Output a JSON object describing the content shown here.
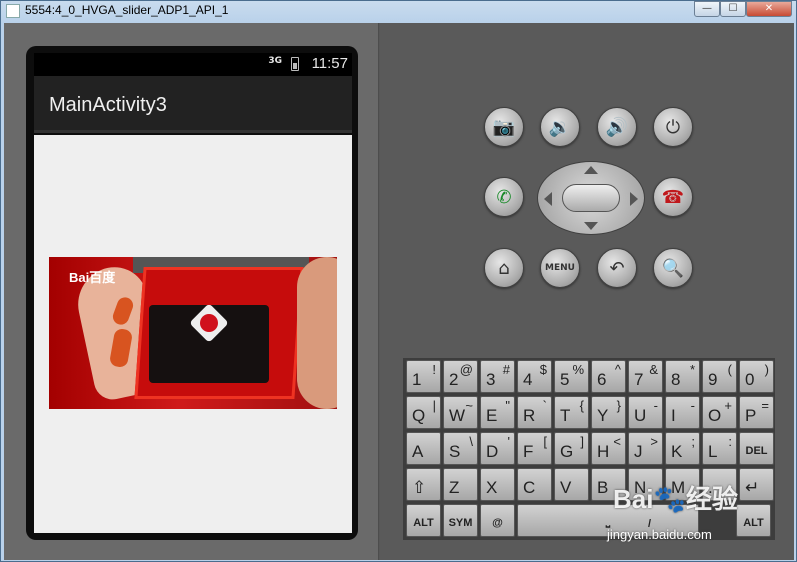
{
  "window": {
    "title": "5554:4_0_HVGA_slider_ADP1_API_1",
    "minimize": "—",
    "maximize": "☐",
    "close": "✕"
  },
  "status_bar": {
    "network": "3G",
    "time": "11:57"
  },
  "app": {
    "title": "MainActivity3"
  },
  "image": {
    "logo_text": "Bai百度"
  },
  "hardware_buttons": {
    "camera": "📷",
    "vol_down": "🔉",
    "vol_up": "🔊",
    "power": "⏻",
    "call": "✆",
    "end_call": "☎",
    "home": "⌂",
    "menu": "MENU",
    "back": "↶",
    "search": "🔍"
  },
  "keyboard": {
    "row1": [
      [
        "1",
        "!"
      ],
      [
        "2",
        "@"
      ],
      [
        "3",
        "#"
      ],
      [
        "4",
        "$"
      ],
      [
        "5",
        "%"
      ],
      [
        "6",
        "^"
      ],
      [
        "7",
        "&"
      ],
      [
        "8",
        "*"
      ],
      [
        "9",
        "("
      ],
      [
        "0",
        ")"
      ]
    ],
    "row2": [
      [
        "Q",
        "|"
      ],
      [
        "W",
        "~"
      ],
      [
        "E",
        "\""
      ],
      [
        "R",
        "`"
      ],
      [
        "T",
        "{"
      ],
      [
        "Y",
        "}"
      ],
      [
        "U",
        "-"
      ],
      [
        "I",
        "-"
      ],
      [
        "O",
        "+"
      ],
      [
        "P",
        "="
      ]
    ],
    "row3": [
      [
        "A",
        ""
      ],
      [
        "S",
        "\\"
      ],
      [
        "D",
        "'"
      ],
      [
        "F",
        "["
      ],
      [
        "G",
        "]"
      ],
      [
        "H",
        "<"
      ],
      [
        "J",
        ">"
      ],
      [
        "K",
        ";"
      ],
      [
        "L",
        ":"
      ],
      [
        "DEL",
        ""
      ]
    ],
    "row4": [
      [
        "⇧",
        ""
      ],
      [
        "Z",
        ""
      ],
      [
        "X",
        ""
      ],
      [
        "C",
        ""
      ],
      [
        "V",
        ""
      ],
      [
        "B",
        ""
      ],
      [
        "N",
        ""
      ],
      [
        "M",
        ""
      ],
      [
        ".",
        ""
      ],
      [
        "↵",
        ""
      ]
    ],
    "row5": [
      "ALT",
      "SYM",
      "@",
      "⎵",
      "/",
      "ALT"
    ]
  },
  "watermark": {
    "logo": "Bai🐾经验",
    "url": "jingyan.baidu.com"
  }
}
